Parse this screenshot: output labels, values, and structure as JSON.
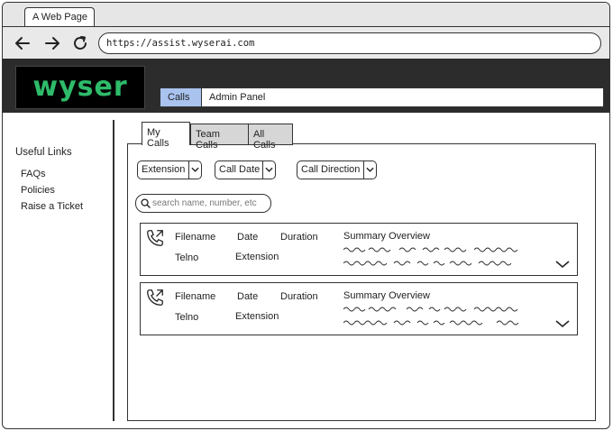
{
  "browser": {
    "tab_title": "A Web Page",
    "url": "https://assist.wyserai.com"
  },
  "app": {
    "logo_text": "wyser",
    "nav": [
      {
        "label": "Calls",
        "active": true
      },
      {
        "label": "Admin Panel",
        "active": false
      }
    ]
  },
  "sidebar": {
    "heading": "Useful Links",
    "links": [
      "FAQs",
      "Policies",
      "Raise a Ticket"
    ]
  },
  "view_tabs": [
    {
      "label": "My Calls",
      "active": true
    },
    {
      "label": "Team Calls",
      "active": false
    },
    {
      "label": "All Calls",
      "active": false
    }
  ],
  "filters": [
    "Extension",
    "Call Date",
    "Call Direction"
  ],
  "search": {
    "placeholder": "search name, number, etc"
  },
  "calls": [
    {
      "filename": "Filename",
      "date": "Date",
      "duration": "Duration",
      "summary_title": "Summary Overview",
      "telno": "Telno",
      "extension": "Extension"
    },
    {
      "filename": "Filename",
      "date": "Date",
      "duration": "Duration",
      "summary_title": "Summary Overview",
      "telno": "Telno",
      "extension": "Extension"
    }
  ],
  "colors": {
    "header_bg": "#2c2c2c",
    "logo_green": "#2ebb6a",
    "active_nav": "#a9c3ee",
    "inactive_tab": "#d6d6d6"
  }
}
